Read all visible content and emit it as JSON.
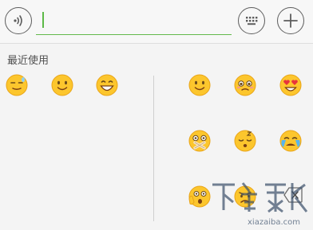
{
  "input_bar": {
    "voice_icon": "voice-wave-icon",
    "keyboard_icon": "keyboard-icon",
    "plus_icon": "plus-icon",
    "accent_color": "#5cb947"
  },
  "emoji_panel": {
    "recent_title": "最近使用",
    "recent_emojis": [
      "embarrassed",
      "smile",
      "grin"
    ],
    "all_emojis": [
      "smile",
      "pleading",
      "heart-eyes",
      "shocked-taped-mouth",
      "sleepy",
      "crying",
      "surprised-hand",
      "sad"
    ]
  },
  "watermark": {
    "site": "xiazaiba.com"
  }
}
